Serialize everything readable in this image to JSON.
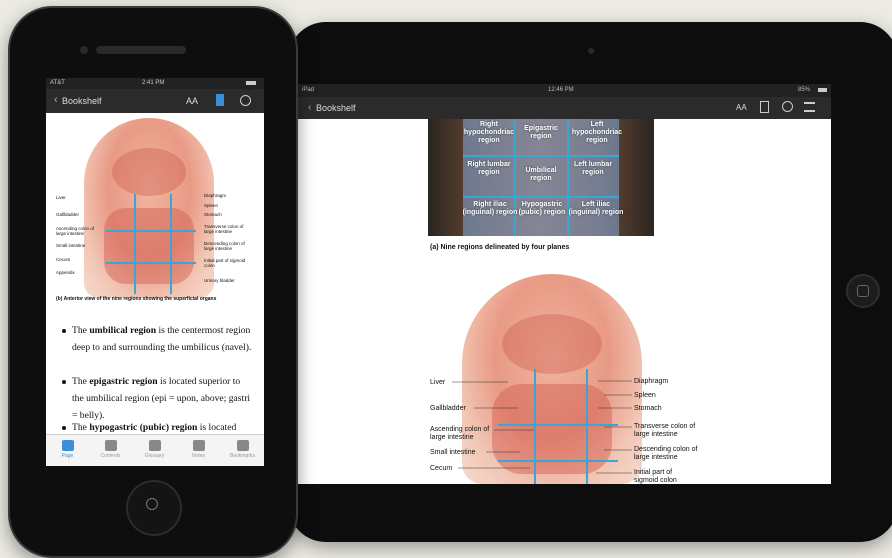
{
  "ipad": {
    "status": {
      "carrier": "iPad",
      "time": "12:46 PM",
      "battery": "85%"
    },
    "nav": {
      "back_label": "Bookshelf",
      "font_icon": "AA"
    },
    "photo_regions": [
      [
        "Right hypochondriac region",
        "Epigastric region",
        "Left hypochondriac region"
      ],
      [
        "Right lumbar region",
        "Umbilical region",
        "Left lumbar region"
      ],
      [
        "Right iliac (inguinal) region",
        "Hypogastric (pubic) region",
        "Left iliac (inguinal) region"
      ]
    ],
    "caption_a": "(a) Nine regions delineated by four planes",
    "labels_left": [
      "Liver",
      "Gallbladder",
      "Ascending colon of large intestine",
      "Small intestine",
      "Cecum"
    ],
    "labels_right": [
      "Diaphragm",
      "Spleen",
      "Stomach",
      "Transverse colon of large intestine",
      "Descending colon of large intestine",
      "Initial part of sigmoid colon"
    ]
  },
  "iphone": {
    "status": {
      "carrier": "AT&T",
      "time": "2:41 PM"
    },
    "nav": {
      "back_label": "Bookshelf",
      "font_icon": "AA"
    },
    "labels_left": [
      "Liver",
      "Gallbladder",
      "Ascending colon of large intestine",
      "Small intestine",
      "Cecum",
      "Appendix"
    ],
    "labels_right": [
      "Diaphragm",
      "Spleen",
      "Stomach",
      "Transverse colon of large intestine",
      "Descending colon of large intestine",
      "Initial part of sigmoid colon",
      "Urinary bladder"
    ],
    "caption_b": "(b) Anterior view of the nine regions showing the superficial organs",
    "bullets": [
      {
        "bold": "umbilical region",
        "pre": "The ",
        "post": " is the centermost region deep to and surrounding the umbilicus (navel)."
      },
      {
        "bold": "epigastric region",
        "pre": "The ",
        "post": " is located superior to the umbilical region (epi = upon, above; gastri = belly)."
      },
      {
        "bold": "hypogastric (pubic) region",
        "pre": "The ",
        "post": " is located"
      }
    ],
    "tabs": [
      {
        "label": "Page",
        "icon": "page-icon"
      },
      {
        "label": "Contents",
        "icon": "list-icon"
      },
      {
        "label": "Glossary",
        "icon": "book-icon"
      },
      {
        "label": "Notes",
        "icon": "note-icon"
      },
      {
        "label": "Bookmarks",
        "icon": "bookmarks-icon"
      }
    ]
  },
  "colors": {
    "accent": "#3a8fd8",
    "navbar": "#2b2b2b",
    "grid_lines": "#39a6d6"
  }
}
